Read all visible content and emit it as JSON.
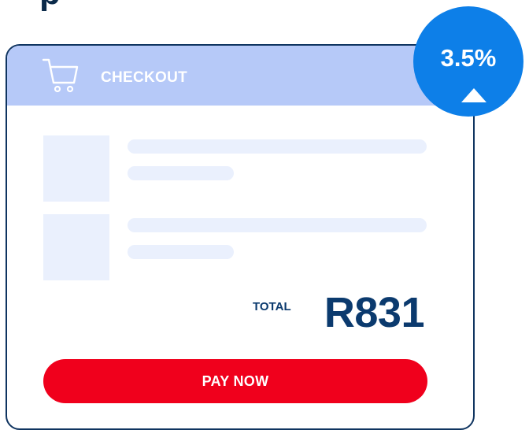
{
  "header": {
    "title": "CHECKOUT",
    "icon": "cart-icon"
  },
  "summary": {
    "total_label": "TOTAL",
    "total_value": "R831"
  },
  "actions": {
    "pay_label": "PAY NOW"
  },
  "badge": {
    "value": "3.5%",
    "trend": "up",
    "icon": "arrow-up-icon"
  },
  "colors": {
    "header_bg": "#b6c9f8",
    "card_border": "#0f3460",
    "total_text": "#0b3a6e",
    "pay_button": "#f0001c",
    "badge_bg": "#0d7fe8",
    "placeholder": "#eaf0fd"
  }
}
